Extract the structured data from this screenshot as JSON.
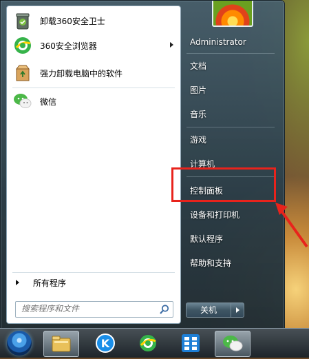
{
  "programs": [
    {
      "label": "卸载360安全卫士",
      "icon": "trash-can-icon",
      "has_arrow": false
    },
    {
      "label": "360安全浏览器",
      "icon": "360-browser-icon",
      "has_arrow": true
    },
    {
      "label": "强力卸载电脑中的软件",
      "icon": "recycle-box-icon",
      "has_arrow": false
    },
    {
      "label": "微信",
      "icon": "wechat-icon",
      "has_arrow": false
    }
  ],
  "all_programs_label": "所有程序",
  "search": {
    "placeholder": "搜索程序和文件"
  },
  "right_items": [
    {
      "label": "Administrator"
    },
    {
      "label": "文档"
    },
    {
      "label": "图片"
    },
    {
      "label": "音乐"
    },
    {
      "label": "游戏"
    },
    {
      "label": "计算机"
    },
    {
      "label": "控制面板"
    },
    {
      "label": "设备和打印机"
    },
    {
      "label": "默认程序"
    },
    {
      "label": "帮助和支持"
    }
  ],
  "shutdown": {
    "label": "关机"
  },
  "taskbar": [
    {
      "icon": "windows-start-orb-icon"
    },
    {
      "icon": "file-explorer-icon",
      "active": true
    },
    {
      "icon": "kugou-music-icon"
    },
    {
      "icon": "360-browser-icon"
    },
    {
      "icon": "app-grid-icon"
    },
    {
      "icon": "wechat-icon",
      "active": true
    }
  ],
  "colors": {
    "highlight": "#e8231c",
    "menu_text": "#ffffff"
  }
}
